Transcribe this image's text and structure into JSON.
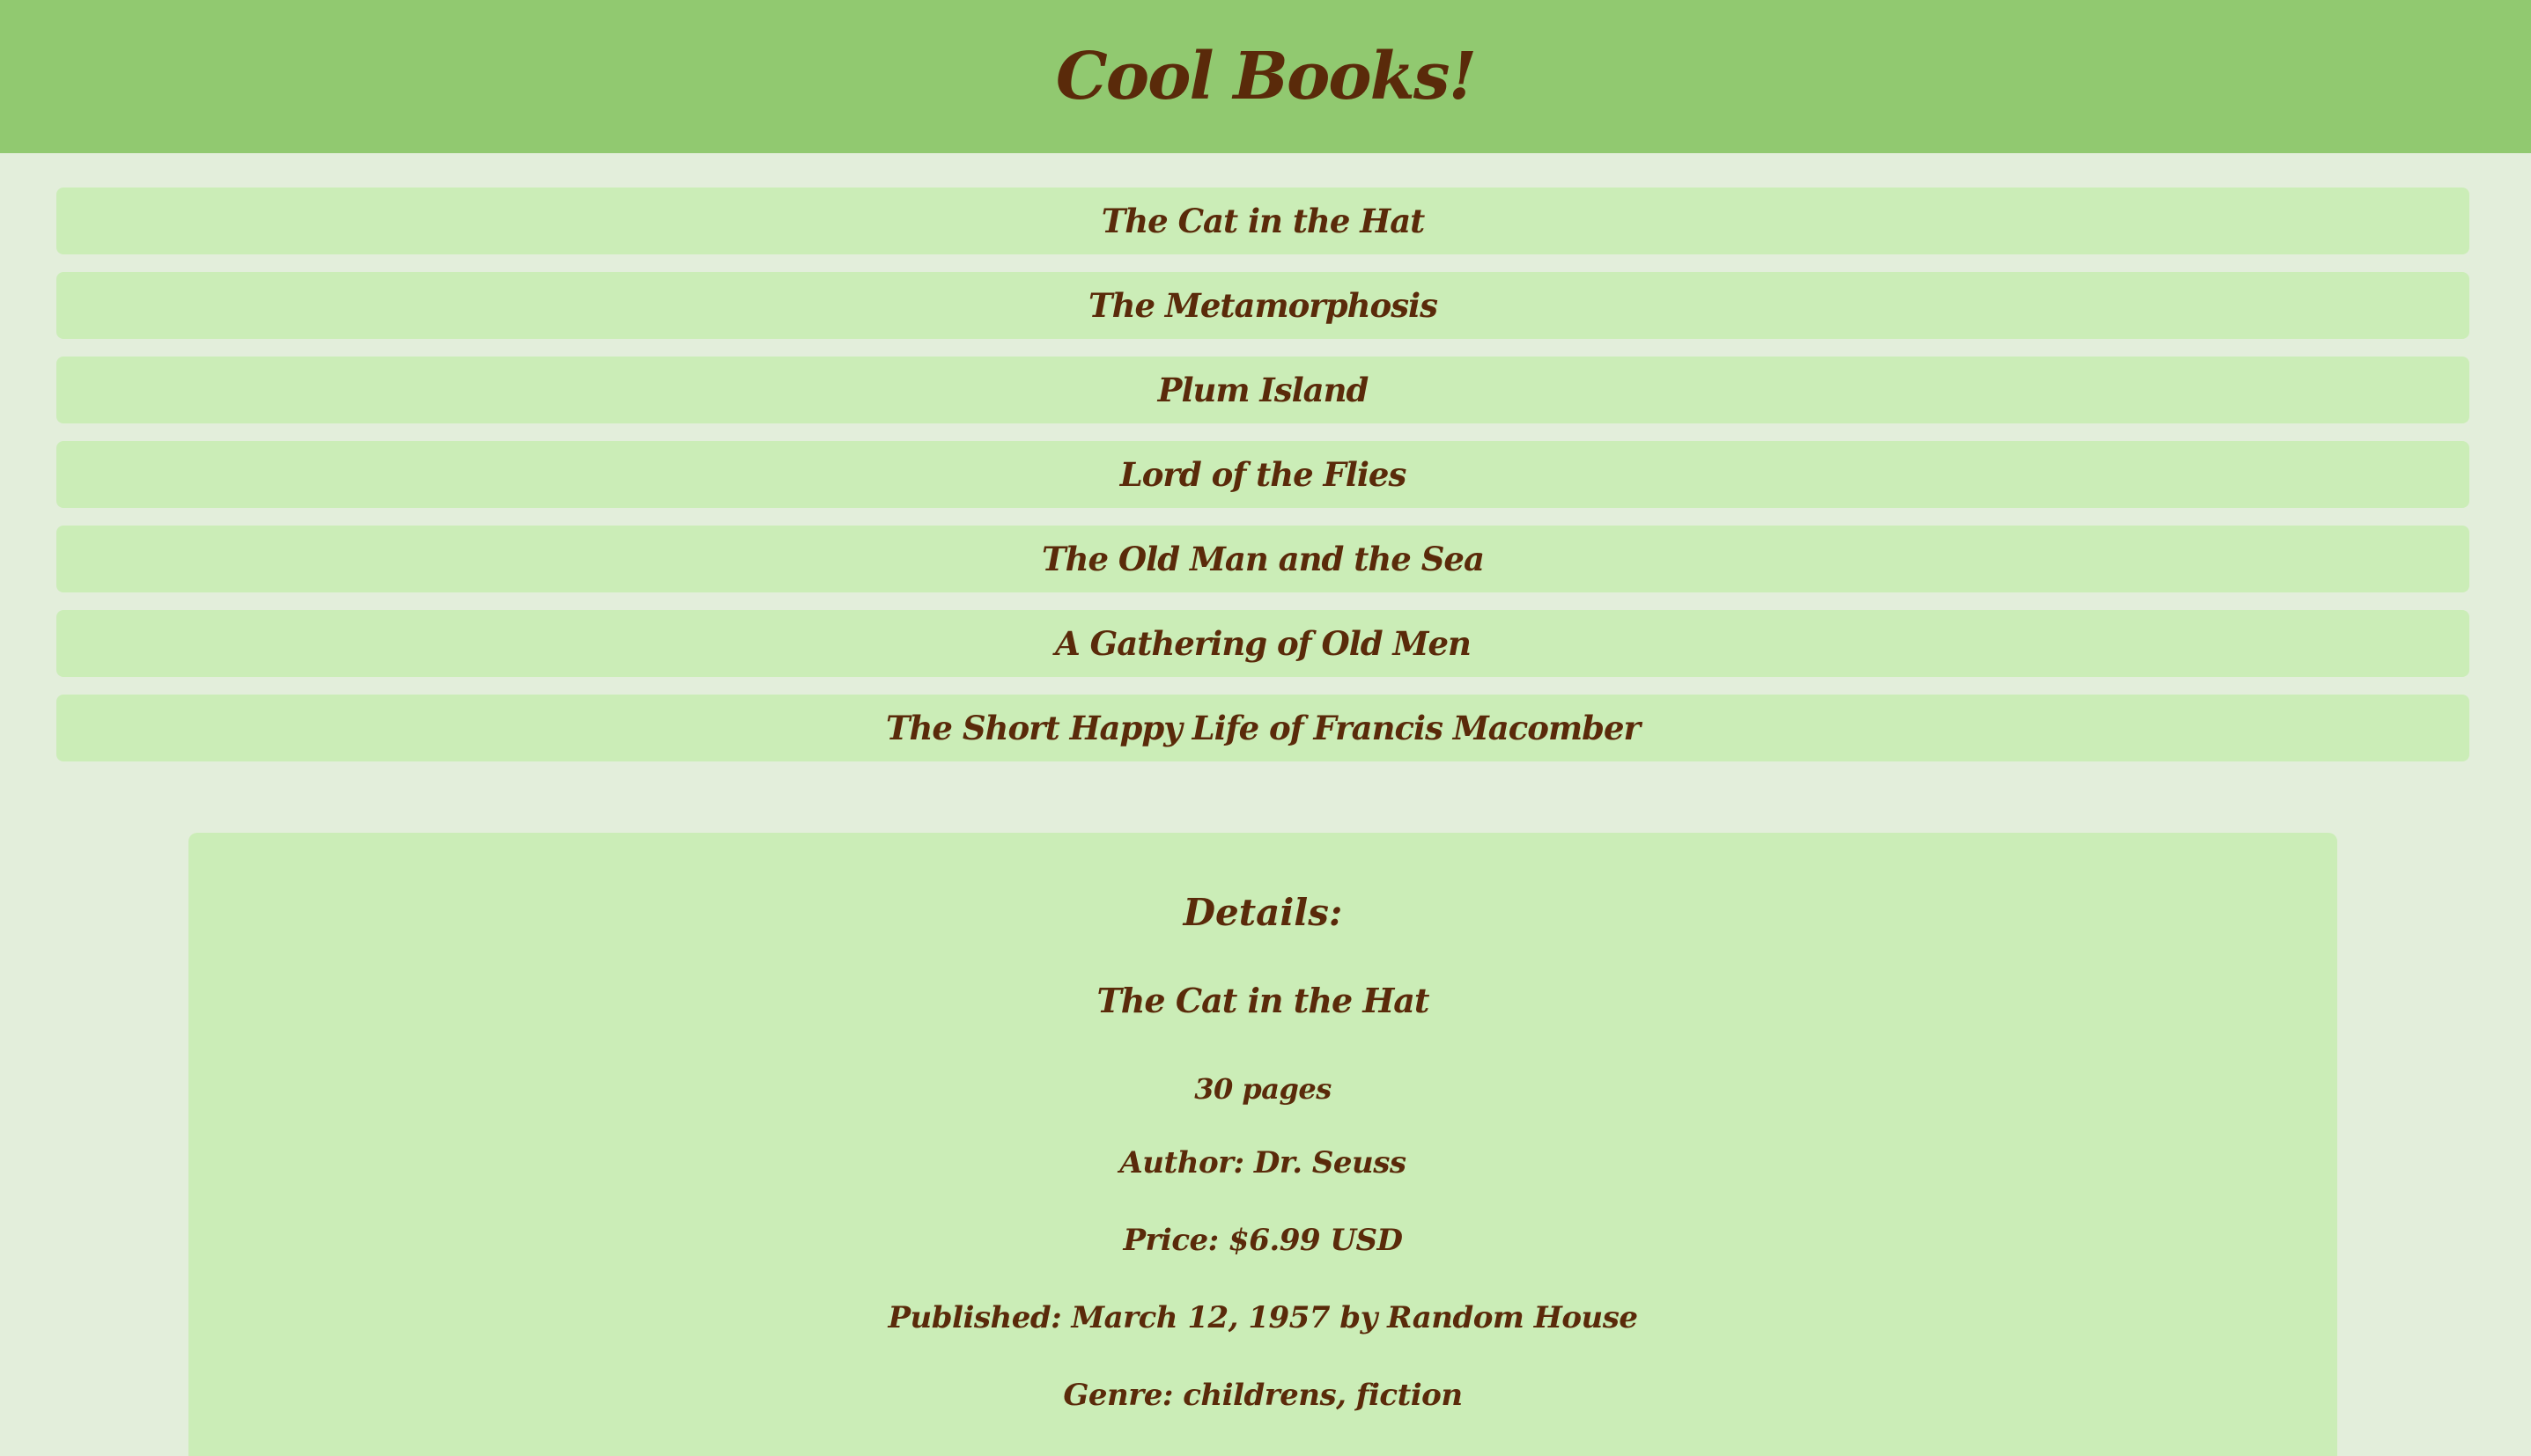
{
  "header": {
    "title": "Cool Books!"
  },
  "books": [
    "The Cat in the Hat",
    "The Metamorphosis",
    "Plum Island",
    "Lord of the Flies",
    "The Old Man and the Sea",
    "A Gathering of Old Men",
    "The Short Happy Life of Francis Macomber"
  ],
  "details": {
    "heading": "Details:",
    "title": "The Cat in the Hat",
    "pages": "30 pages",
    "author": "Author: Dr. Seuss",
    "price": "Price: $6.99 USD",
    "published": "Published: March 12, 1957 by Random House",
    "genre": "Genre: childrens, fiction"
  },
  "colors": {
    "header_bg": "#91c970",
    "page_bg": "#e3eedb",
    "panel_bg": "#cbedb7",
    "text": "#5a2a0a"
  }
}
